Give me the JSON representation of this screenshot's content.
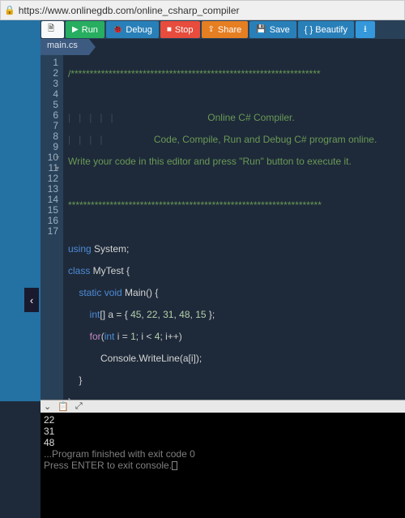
{
  "url": "https://www.onlinegdb.com/online_csharp_compiler",
  "toolbar": {
    "run": "Run",
    "debug": "Debug",
    "stop": "Stop",
    "share": "Share",
    "save": "Save",
    "beautify": "{ } Beautify"
  },
  "tab": "main.cs",
  "code": {
    "l1": "/******************************************************************",
    "l2": "",
    "l3": "                            Online C# Compiler.",
    "l4": "                Code, Compile, Run and Debug C# program online.",
    "l5": "Write your code in this editor and press \"Run\" button to execute it.",
    "l6": "",
    "l7": "*******************************************************************",
    "l8": "",
    "l9a": "using",
    "l9b": " System;",
    "l10a": "class",
    "l10b": " MyTest {",
    "l11a": "static",
    "l11b": "void",
    "l11c": " Main() {",
    "l12a": "int",
    "l12b": "[] a = { ",
    "l12n1": "45",
    "l12n2": "22",
    "l12n3": "31",
    "l12n4": "48",
    "l12n5": "15",
    "l12c": " };",
    "l13a": "for",
    "l13b": "(",
    "l13c": "int",
    "l13d": " i = ",
    "l13n1": "1",
    "l13e": "; i < ",
    "l13n2": "4",
    "l13f": "; i++)",
    "l14": "Console.WriteLine(a[i]);",
    "l15": "}",
    "l16": "}",
    "l17": ""
  },
  "console": {
    "out1": "22",
    "out2": "31",
    "out3": "48",
    "blank": "",
    "msg1": "...Program finished with exit code 0",
    "msg2": "Press ENTER to exit console."
  }
}
